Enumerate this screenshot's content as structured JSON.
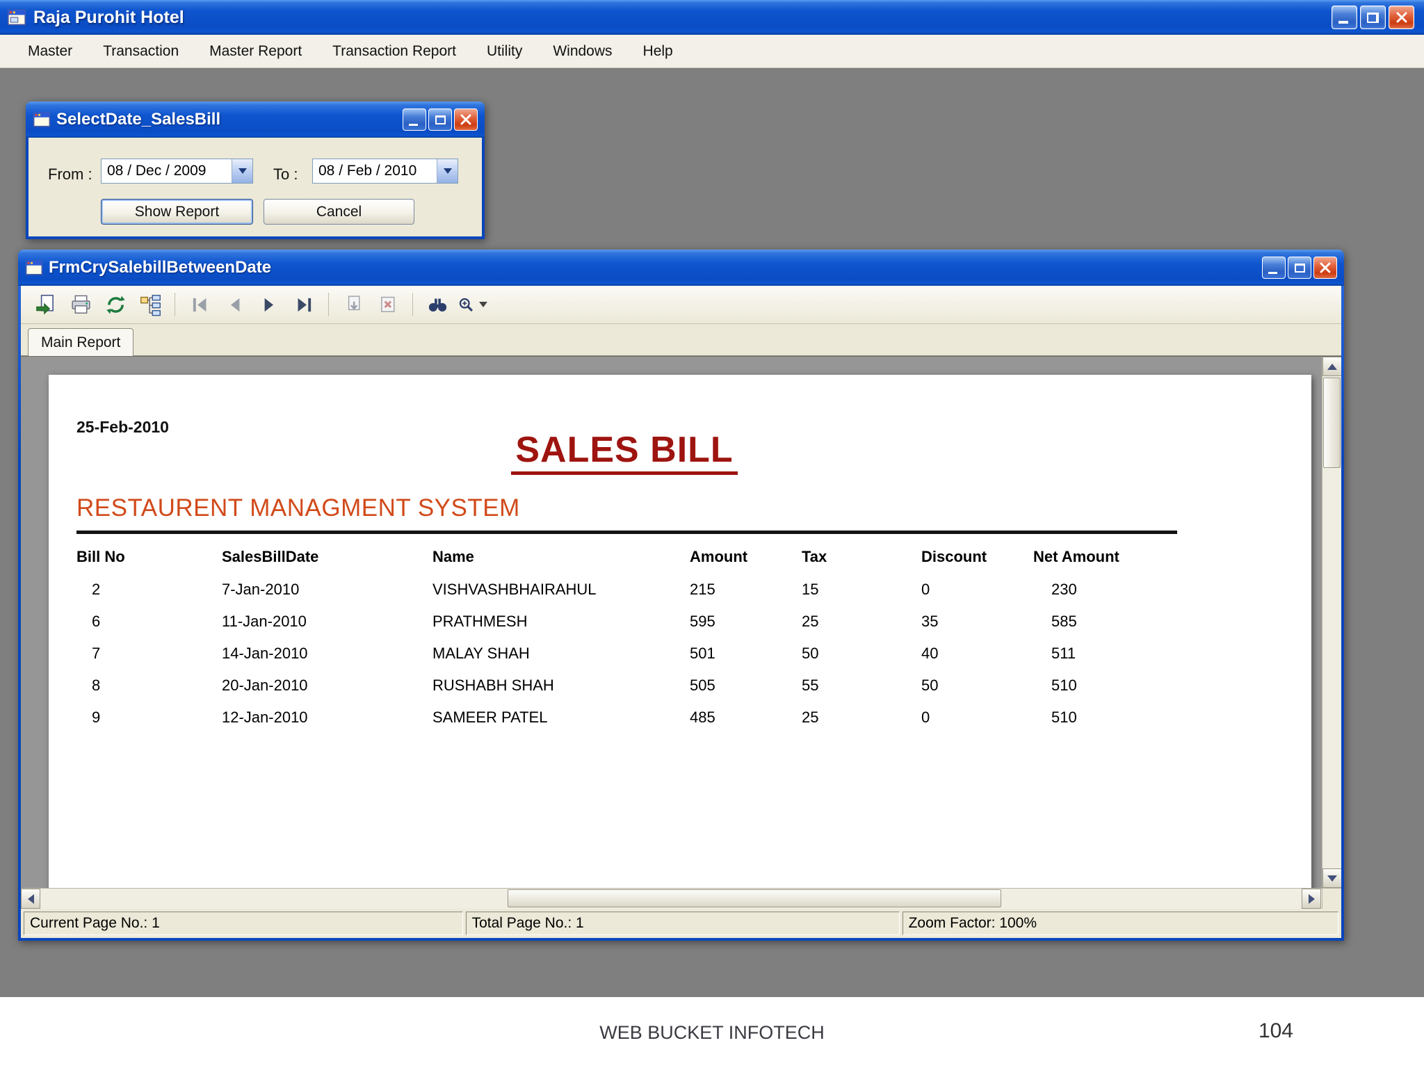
{
  "app": {
    "title": "Raja Purohit Hotel",
    "menu": [
      "Master",
      "Transaction",
      "Master Report",
      "Transaction Report",
      "Utility",
      "Windows",
      "Help"
    ]
  },
  "dialog": {
    "title": "SelectDate_SalesBill",
    "from_label": "From :",
    "from_value": "08 / Dec / 2009",
    "to_label": "To :",
    "to_value": "08 / Feb / 2010",
    "show_report": "Show Report",
    "cancel": "Cancel"
  },
  "report_window": {
    "title": "FrmCrySalebillBetweenDate",
    "tab": "Main Report",
    "status": {
      "current_page": "Current Page No.: 1",
      "total_page": "Total Page No.: 1",
      "zoom": "Zoom Factor: 100%"
    }
  },
  "report": {
    "date": "25-Feb-2010",
    "title": "SALES BILL",
    "subtitle": "RESTAURENT MANAGMENT SYSTEM",
    "columns": [
      "Bill No",
      "SalesBillDate",
      "Name",
      "Amount",
      "Tax",
      "Discount",
      "Net Amount"
    ],
    "rows": [
      [
        "2",
        "7-Jan-2010",
        "VISHVASHBHAIRAHUL",
        "215",
        "15",
        "0",
        "230"
      ],
      [
        "6",
        "11-Jan-2010",
        "PRATHMESH",
        "595",
        "25",
        "35",
        "585"
      ],
      [
        "7",
        "14-Jan-2010",
        "MALAY SHAH",
        "501",
        "50",
        "40",
        "511"
      ],
      [
        "8",
        "20-Jan-2010",
        "RUSHABH SHAH",
        "505",
        "55",
        "50",
        "510"
      ],
      [
        "9",
        "12-Jan-2010",
        "SAMEER PATEL",
        "485",
        "25",
        "0",
        "510"
      ]
    ]
  },
  "footer": {
    "text": "WEB BUCKET INFOTECH",
    "page": "104"
  },
  "icons": {
    "toolbar": [
      "export-icon",
      "print-icon",
      "refresh-icon",
      "group-tree-icon",
      "first-page-icon",
      "prev-page-icon",
      "next-page-icon",
      "last-page-icon",
      "goto-page-icon",
      "close-view-icon",
      "find-icon",
      "zoom-icon"
    ]
  },
  "colors": {
    "titlebar_blue": "#0f55cf",
    "report_title_red": "#9e1410",
    "subtitle_orange": "#d14a1a",
    "mdi_gray": "#7f7f7f",
    "face": "#ece9d8"
  }
}
